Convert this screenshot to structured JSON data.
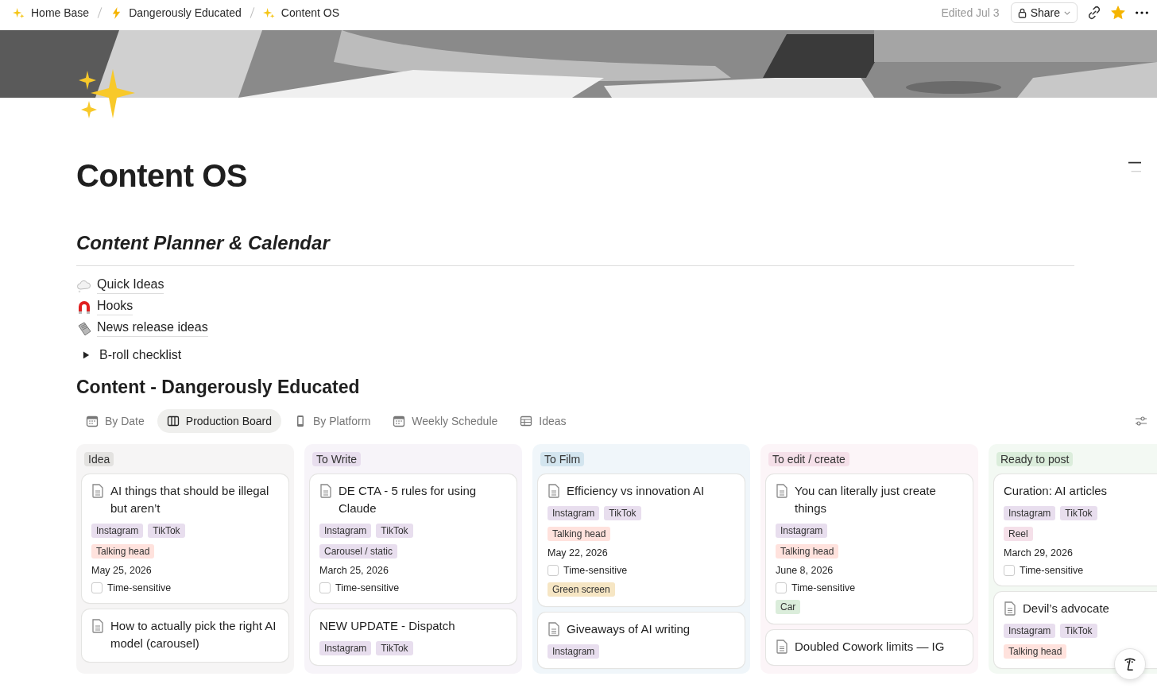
{
  "breadcrumbs": [
    {
      "label": "Home Base"
    },
    {
      "label": "Dangerously Educated"
    },
    {
      "label": "Content OS"
    }
  ],
  "topbar": {
    "edited": "Edited Jul 3",
    "share": "Share",
    "favorite": true
  },
  "page": {
    "title": "Content OS"
  },
  "section_heading": "Content Planner & Calendar",
  "links": [
    {
      "label": "Quick Ideas"
    },
    {
      "label": "Hooks"
    },
    {
      "label": "News release ideas"
    }
  ],
  "toggle": {
    "label": "B-roll checklist",
    "expanded": false
  },
  "database": {
    "title": "Content - Dangerously Educated",
    "views": [
      {
        "label": "By Date",
        "selected": false
      },
      {
        "label": "Production Board",
        "selected": true
      },
      {
        "label": "By Platform",
        "selected": false
      },
      {
        "label": "Weekly Schedule",
        "selected": false
      },
      {
        "label": "Ideas",
        "selected": false
      }
    ],
    "columns": [
      {
        "name": "Idea",
        "color": "#e3e2e0",
        "cards": [
          {
            "title": "AI things that should be illegal but aren’t",
            "page_icon": true,
            "platforms": [
              {
                "label": "Instagram",
                "color": "#e8deee"
              },
              {
                "label": "TikTok",
                "color": "#e8deee"
              }
            ],
            "formats": [
              {
                "label": "Talking head",
                "color": "#ffe2dd"
              }
            ],
            "date": "May 25, 2026",
            "flag": {
              "label": "Time-sensitive",
              "checked": false
            }
          },
          {
            "title": "How to actually pick the right AI model (carousel)",
            "page_icon": true
          }
        ]
      },
      {
        "name": "To Write",
        "color": "#e8deee",
        "cards": [
          {
            "title": "DE CTA - 5 rules for using Claude",
            "page_icon": true,
            "platforms": [
              {
                "label": "Instagram",
                "color": "#e8deee"
              },
              {
                "label": "TikTok",
                "color": "#e8deee"
              }
            ],
            "formats": [
              {
                "label": "Carousel / static",
                "color": "#e8deee"
              }
            ],
            "date": "March 25, 2026",
            "flag": {
              "label": "Time-sensitive",
              "checked": false
            }
          },
          {
            "title": "NEW UPDATE - Dispatch",
            "page_icon": false,
            "platforms": [
              {
                "label": "Instagram",
                "color": "#e8deee"
              },
              {
                "label": "TikTok",
                "color": "#e8deee"
              }
            ]
          }
        ]
      },
      {
        "name": "To Film",
        "color": "#d3e5ef",
        "cards": [
          {
            "title": "Efficiency vs innovation AI",
            "page_icon": true,
            "platforms": [
              {
                "label": "Instagram",
                "color": "#e8deee"
              },
              {
                "label": "TikTok",
                "color": "#e8deee"
              }
            ],
            "formats": [
              {
                "label": "Talking head",
                "color": "#ffe2dd"
              }
            ],
            "date": "May 22, 2026",
            "flag": {
              "label": "Time-sensitive",
              "checked": false
            },
            "extras": [
              {
                "label": "Green screen",
                "color": "#f6e6c4"
              }
            ]
          },
          {
            "title": "Giveaways of AI writing",
            "page_icon": true,
            "platforms": [
              {
                "label": "Instagram",
                "color": "#e8deee"
              }
            ]
          }
        ]
      },
      {
        "name": "To edit / create",
        "color": "#f5e0e9",
        "cards": [
          {
            "title": "You can literally just create things",
            "page_icon": true,
            "platforms": [
              {
                "label": "Instagram",
                "color": "#e8deee"
              }
            ],
            "formats": [
              {
                "label": "Talking head",
                "color": "#ffe2dd"
              }
            ],
            "date": "June 8, 2026",
            "flag": {
              "label": "Time-sensitive",
              "checked": false
            },
            "extras": [
              {
                "label": "Car",
                "color": "#dbeddb"
              }
            ]
          },
          {
            "title": "Doubled Cowork limits — IG",
            "page_icon": true
          }
        ]
      },
      {
        "name": "Ready to post",
        "color": "#dbeddb",
        "cards": [
          {
            "title": "Curation: AI articles",
            "page_icon": false,
            "platforms": [
              {
                "label": "Instagram",
                "color": "#e8deee"
              },
              {
                "label": "TikTok",
                "color": "#e8deee"
              }
            ],
            "formats": [
              {
                "label": "Reel",
                "color": "#f5e0e9"
              }
            ],
            "date": "March 29, 2026",
            "flag": {
              "label": "Time-sensitive",
              "checked": false
            }
          },
          {
            "title": "Devil’s advocate",
            "page_icon": true,
            "platforms": [
              {
                "label": "Instagram",
                "color": "#e8deee"
              },
              {
                "label": "TikTok",
                "color": "#e8deee"
              }
            ],
            "formats": [
              {
                "label": "Talking head",
                "color": "#ffe2dd"
              }
            ]
          }
        ]
      }
    ]
  }
}
